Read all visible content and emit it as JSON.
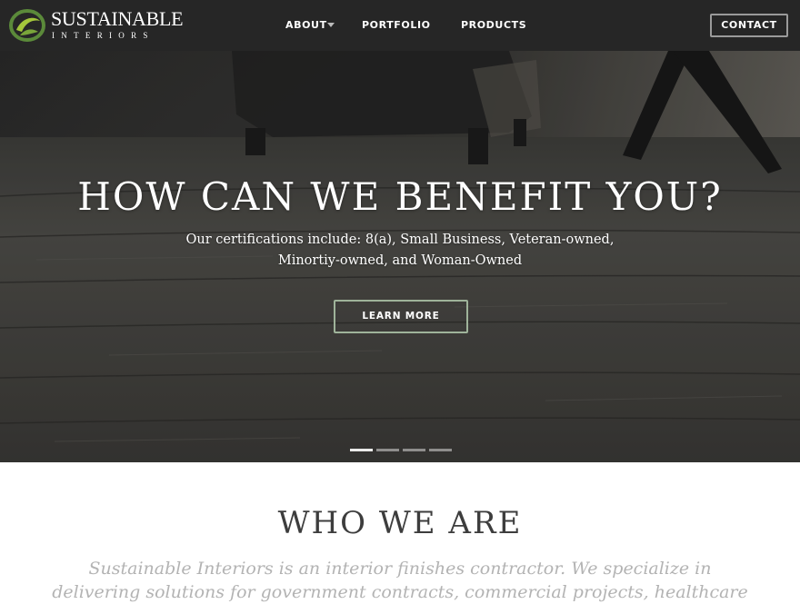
{
  "nav": {
    "logo": {
      "line1": "SUSTAINABLE",
      "line2": "INTERIORS",
      "brand_colors": [
        "#5b8a3a",
        "#a4c63b"
      ]
    },
    "links": [
      {
        "label": "ABOUT",
        "has_dropdown": true,
        "dropdown_icon": "caret-down-icon"
      },
      {
        "label": "PORTFOLIO"
      },
      {
        "label": "PRODUCTS"
      }
    ],
    "contact_label": "CONTACT",
    "background": "#262626"
  },
  "hero": {
    "title": "HOW CAN WE BENEFIT YOU?",
    "subtitle_line1": "Our certifications include: 8(a), Small Business, Veteran-owned,",
    "subtitle_line2": "Minortiy-owned, and Woman-Owned",
    "cta_label": "LEARN MORE",
    "cta_border_color": "#9fb39a",
    "slides_count": 4,
    "active_slide": 1
  },
  "who": {
    "title": "WHO WE ARE",
    "text_line1": "Sustainable Interiors is an interior finishes contractor.  We specialize in",
    "text_line2": "delivering solutions for government contracts, commercial projects, healthcare"
  }
}
